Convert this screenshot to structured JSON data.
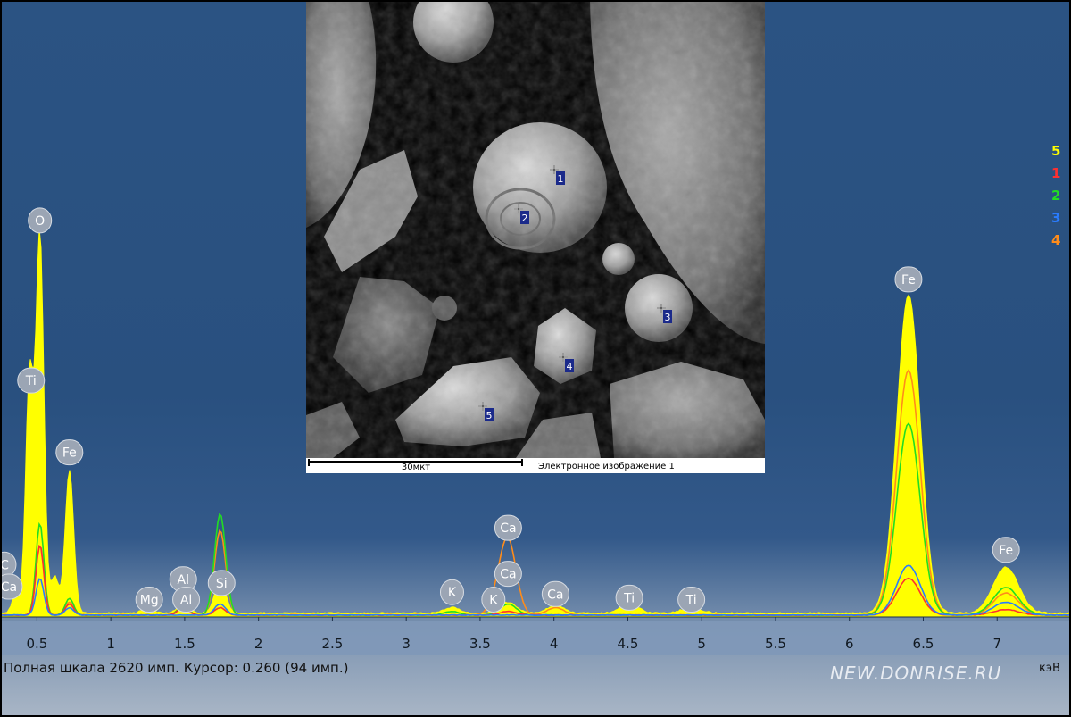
{
  "chart_data": {
    "type": "line",
    "xlim": [
      0.25,
      7.5
    ],
    "ylim": [
      0,
      2620
    ],
    "x_ticks": [
      "0.5",
      "1",
      "1.5",
      "2",
      "2.5",
      "3",
      "3.5",
      "4",
      "4.5",
      "5",
      "5.5",
      "6",
      "6.5",
      "7"
    ],
    "series": [
      {
        "name": "5",
        "color": "#ffff00",
        "peaks": [
          [
            0.52,
            2060
          ],
          [
            0.45,
            1300
          ],
          [
            0.72,
            780
          ],
          [
            0.36,
            120
          ],
          [
            0.62,
            200
          ],
          [
            1.25,
            40
          ],
          [
            1.49,
            60
          ],
          [
            1.74,
            170
          ],
          [
            3.31,
            30
          ],
          [
            3.69,
            60
          ],
          [
            4.01,
            40
          ],
          [
            4.51,
            50
          ],
          [
            4.93,
            30
          ],
          [
            6.4,
            1730
          ],
          [
            7.06,
            250
          ]
        ]
      },
      {
        "name": "1",
        "color": "#ff3030",
        "peaks": [
          [
            0.52,
            380
          ],
          [
            0.72,
            60
          ],
          [
            1.49,
            40
          ],
          [
            1.74,
            40
          ],
          [
            3.69,
            20
          ],
          [
            6.4,
            200
          ],
          [
            7.06,
            30
          ]
        ]
      },
      {
        "name": "2",
        "color": "#22dd22",
        "peaks": [
          [
            0.52,
            500
          ],
          [
            0.72,
            90
          ],
          [
            1.49,
            50
          ],
          [
            1.74,
            550
          ],
          [
            3.31,
            20
          ],
          [
            3.69,
            60
          ],
          [
            6.4,
            1040
          ],
          [
            7.06,
            150
          ]
        ]
      },
      {
        "name": "3",
        "color": "#2a7cff",
        "peaks": [
          [
            0.52,
            200
          ],
          [
            0.72,
            40
          ],
          [
            1.74,
            60
          ],
          [
            6.4,
            270
          ],
          [
            7.06,
            70
          ]
        ]
      },
      {
        "name": "4",
        "color": "#ff8c1a",
        "peaks": [
          [
            0.52,
            380
          ],
          [
            0.72,
            70
          ],
          [
            1.49,
            60
          ],
          [
            1.74,
            460
          ],
          [
            3.62,
            70
          ],
          [
            3.69,
            390
          ],
          [
            4.01,
            40
          ],
          [
            6.4,
            1330
          ],
          [
            7.06,
            120
          ]
        ]
      }
    ],
    "annotations": [
      {
        "label": "O",
        "x": 0.52,
        "y": 2150
      },
      {
        "label": "Ti",
        "x": 0.46,
        "y": 1280
      },
      {
        "label": "Fe",
        "x": 0.72,
        "y": 890
      },
      {
        "label": "C",
        "x": 0.28,
        "y": 280
      },
      {
        "label": "Ca",
        "x": 0.31,
        "y": 160
      },
      {
        "label": "Mg",
        "x": 1.26,
        "y": 90
      },
      {
        "label": "Al",
        "x": 1.49,
        "y": 200
      },
      {
        "label": "Al",
        "x": 1.51,
        "y": 90
      },
      {
        "label": "Si",
        "x": 1.75,
        "y": 180
      },
      {
        "label": "K",
        "x": 3.31,
        "y": 130
      },
      {
        "label": "Ca",
        "x": 3.69,
        "y": 480
      },
      {
        "label": "K",
        "x": 3.59,
        "y": 90
      },
      {
        "label": "Ca",
        "x": 3.69,
        "y": 230
      },
      {
        "label": "Ca",
        "x": 4.01,
        "y": 120
      },
      {
        "label": "Ti",
        "x": 4.51,
        "y": 100
      },
      {
        "label": "Ti",
        "x": 4.93,
        "y": 90
      },
      {
        "label": "Fe",
        "x": 6.4,
        "y": 1830
      },
      {
        "label": "Fe",
        "x": 7.06,
        "y": 360
      }
    ],
    "colors": {
      "label_bubble": "#9ba5b4",
      "baseline": "#ffff00"
    }
  },
  "status": {
    "text": "Полная шкала 2620 имп. Курсор: 0.260  (94 имп.)",
    "unit": "кэВ"
  },
  "sem_image": {
    "scale_label": "30мкт",
    "caption": "Электронное изображение 1",
    "points": [
      "1",
      "2",
      "3",
      "4",
      "5"
    ],
    "marker_color": "#1b2a8a"
  },
  "watermark": "NEW.DONRISE.RU"
}
